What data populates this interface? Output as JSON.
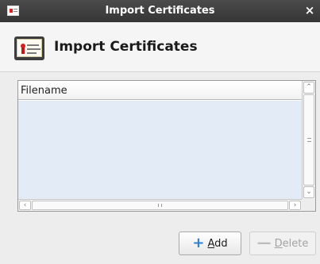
{
  "window": {
    "title": "Import Certificates",
    "close_glyph": "×",
    "icon": "certificate-window-icon"
  },
  "header": {
    "title": "Import Certificates",
    "icon": "certificate-icon"
  },
  "file_list": {
    "columns": [
      "Filename"
    ],
    "rows": [],
    "vertical_scroll_grip": "≡",
    "horizontal_scroll_grip": "III"
  },
  "buttons": {
    "add": {
      "icon": "+",
      "accel": "A",
      "rest": "dd",
      "enabled": true
    },
    "delete": {
      "icon": "—",
      "accel": "D",
      "rest": "elete",
      "enabled": false
    }
  },
  "colors": {
    "titlebar": "#3f3f3f",
    "list_body": "#e3ebf6",
    "add_icon": "#2f7fd6"
  }
}
